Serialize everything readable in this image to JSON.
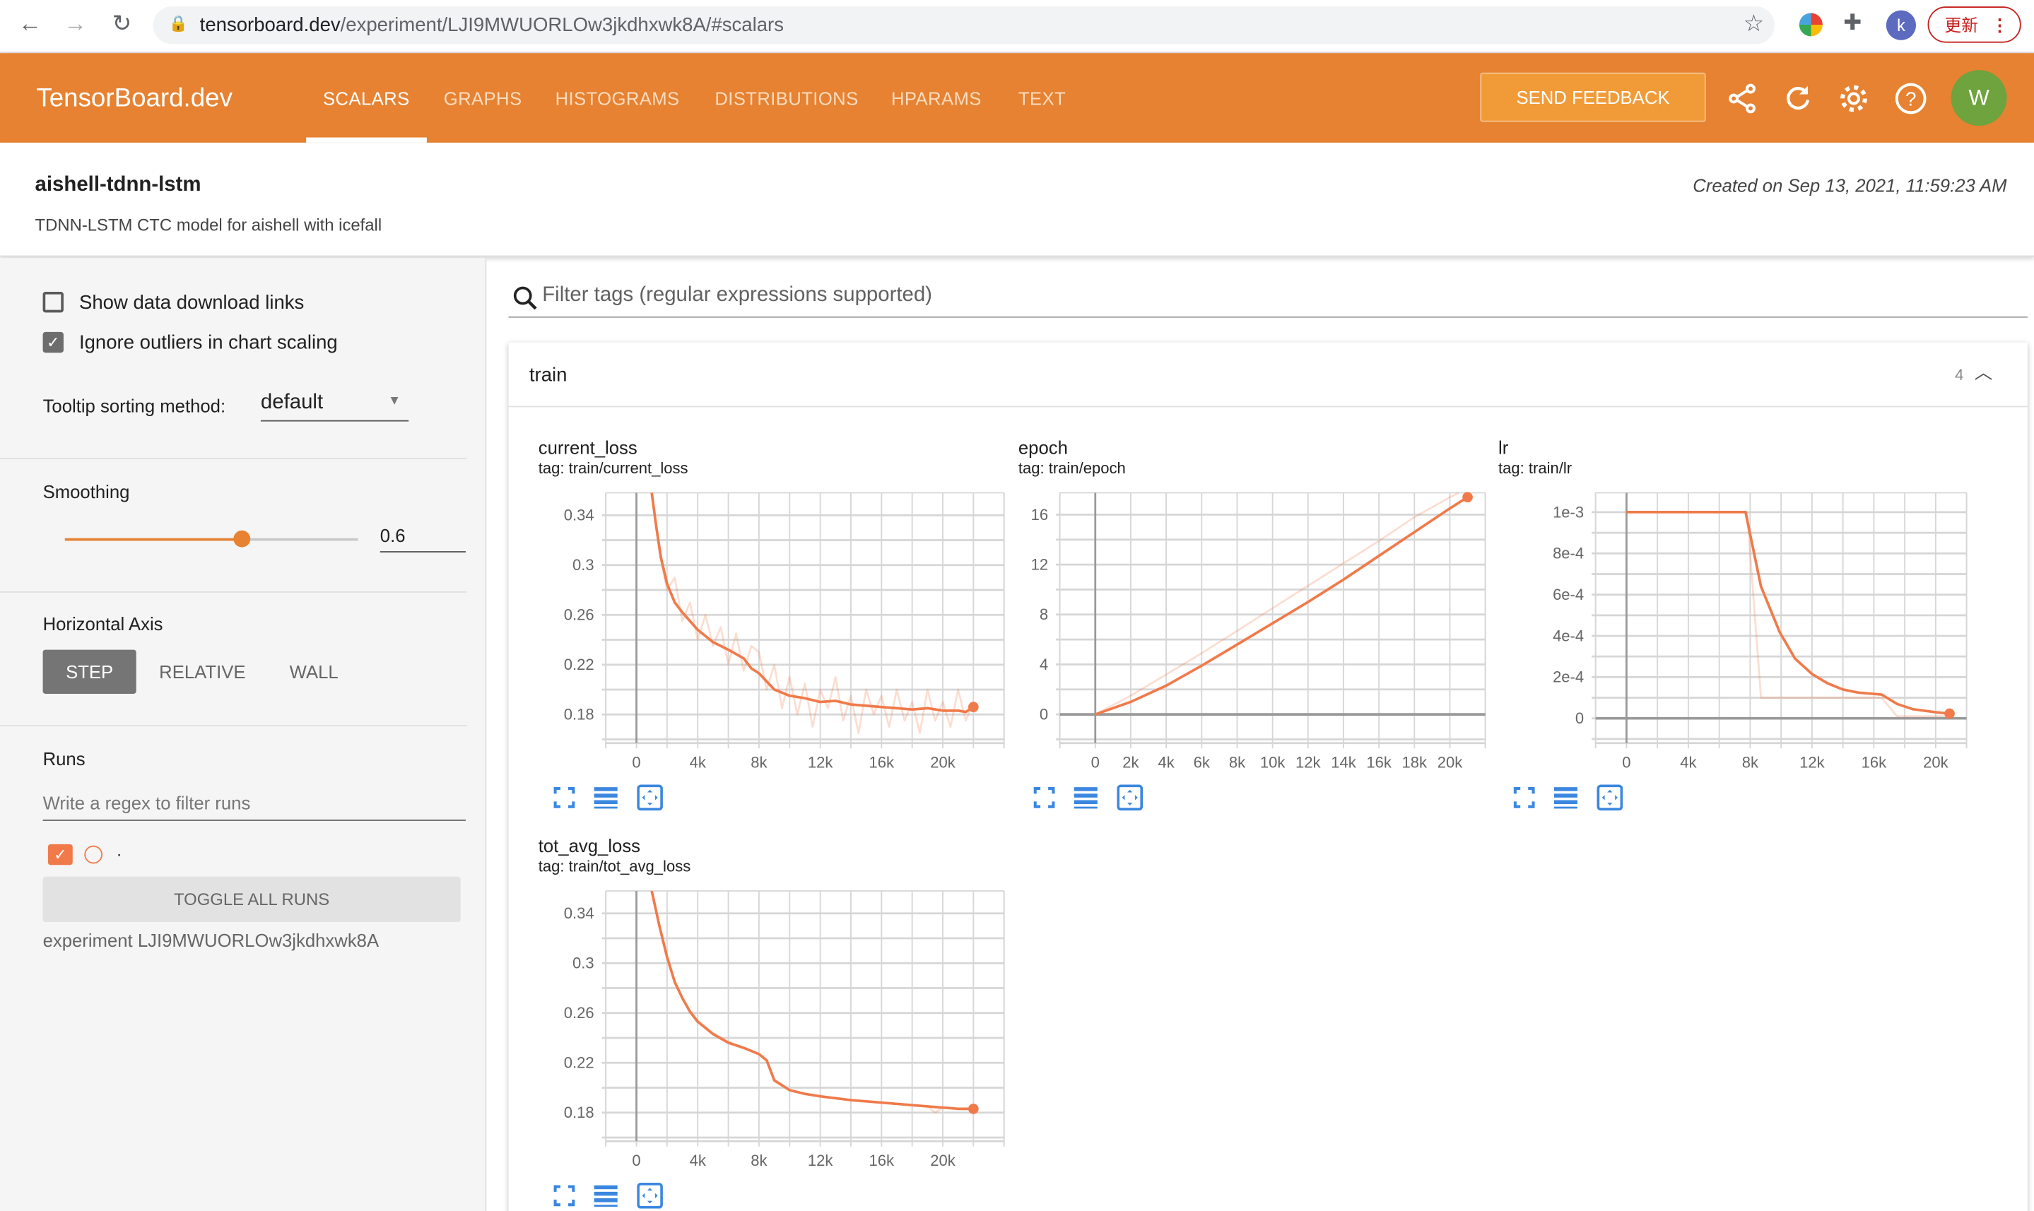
{
  "browser": {
    "url_host": "tensorboard.dev",
    "url_path": "/experiment/LJI9MWUORLOw3jkdhxwk8A/#scalars",
    "profile_initial": "k",
    "update_label": "更新"
  },
  "header": {
    "brand": "TensorBoard.dev",
    "tabs": [
      {
        "label": "SCALARS",
        "active": true
      },
      {
        "label": "GRAPHS"
      },
      {
        "label": "HISTOGRAMS"
      },
      {
        "label": "DISTRIBUTIONS"
      },
      {
        "label": "HPARAMS"
      },
      {
        "label": "TEXT"
      }
    ],
    "feedback_label": "SEND FEEDBACK",
    "avatar_initial": "W",
    "colors": {
      "brand": "#e68231",
      "avatar": "#6ea33e"
    }
  },
  "experiment": {
    "title": "aishell-tdnn-lstm",
    "description": "TDNN-LSTM CTC model for aishell with icefall",
    "created": "Created on Sep 13, 2021, 11:59:23 AM"
  },
  "sidebar": {
    "show_download_links": {
      "label": "Show data download links",
      "checked": false
    },
    "ignore_outliers": {
      "label": "Ignore outliers in chart scaling",
      "checked": true
    },
    "tooltip_label": "Tooltip sorting method:",
    "tooltip_value": "default",
    "smoothing_label": "Smoothing",
    "smoothing_value": "0.6",
    "smoothing_fraction": 0.6,
    "horizontal_axis_label": "Horizontal Axis",
    "axis_options": [
      "STEP",
      "RELATIVE",
      "WALL"
    ],
    "axis_selected": "STEP",
    "runs_label": "Runs",
    "runs_filter_placeholder": "Write a regex to filter runs",
    "runs": [
      {
        "name": ".",
        "checked": true,
        "color": "#f07a4a"
      }
    ],
    "toggle_all_label": "TOGGLE ALL RUNS",
    "experiment_label": "experiment LJI9MWUORLOw3jkdhxwk8A"
  },
  "main": {
    "filter_placeholder": "Filter tags (regular expressions supported)",
    "group": {
      "title": "train",
      "count": "4"
    }
  },
  "chart_data": [
    {
      "type": "line",
      "title": "current_loss",
      "tag": "tag: train/current_loss",
      "xlim": [
        -2000,
        24000
      ],
      "ylim": [
        0.157,
        0.358
      ],
      "xticks": {
        "values": [
          0,
          4000,
          8000,
          12000,
          16000,
          20000
        ],
        "labels": [
          "0",
          "4k",
          "8k",
          "12k",
          "16k",
          "20k"
        ]
      },
      "yticks": {
        "values": [
          0.18,
          0.22,
          0.26,
          0.3,
          0.34
        ],
        "labels": [
          "0.18",
          "0.22",
          "0.26",
          "0.3",
          "0.34"
        ]
      },
      "grid": true,
      "series": [
        {
          "role": "raw",
          "x": [
            1000,
            1500,
            2000,
            2500,
            3000,
            3500,
            4000,
            4500,
            5000,
            5500,
            6000,
            6500,
            7000,
            7500,
            8000,
            8500,
            9000,
            9500,
            10000,
            10500,
            11000,
            11500,
            12000,
            12500,
            13000,
            13500,
            14000,
            14500,
            15000,
            15500,
            16000,
            16500,
            17000,
            17500,
            18000,
            18500,
            19000,
            19500,
            20000,
            20500,
            21000,
            21500,
            22000
          ],
          "y": [
            0.36,
            0.31,
            0.28,
            0.29,
            0.255,
            0.27,
            0.24,
            0.26,
            0.235,
            0.25,
            0.22,
            0.245,
            0.215,
            0.235,
            0.23,
            0.2,
            0.22,
            0.185,
            0.21,
            0.18,
            0.205,
            0.17,
            0.2,
            0.185,
            0.21,
            0.175,
            0.195,
            0.165,
            0.2,
            0.18,
            0.195,
            0.17,
            0.2,
            0.175,
            0.19,
            0.165,
            0.2,
            0.175,
            0.19,
            0.17,
            0.2,
            0.175,
            0.19
          ]
        },
        {
          "role": "smoothed",
          "x": [
            1000,
            1300,
            1600,
            2000,
            2500,
            3000,
            3500,
            4000,
            5000,
            6000,
            7000,
            7500,
            8000,
            9000,
            10000,
            11000,
            12000,
            13000,
            14000,
            15000,
            16000,
            17000,
            18000,
            19000,
            20000,
            21000,
            21500,
            22000
          ],
          "y": [
            0.358,
            0.33,
            0.306,
            0.285,
            0.27,
            0.262,
            0.255,
            0.248,
            0.238,
            0.232,
            0.225,
            0.217,
            0.213,
            0.2,
            0.195,
            0.193,
            0.19,
            0.191,
            0.188,
            0.187,
            0.186,
            0.185,
            0.184,
            0.185,
            0.183,
            0.183,
            0.182,
            0.186
          ]
        }
      ]
    },
    {
      "type": "line",
      "title": "epoch",
      "tag": "tag: train/epoch",
      "xlim": [
        -2000,
        22000
      ],
      "ylim": [
        -2.3,
        17.75
      ],
      "xticks": {
        "values": [
          0,
          2000,
          4000,
          6000,
          8000,
          10000,
          12000,
          14000,
          16000,
          18000,
          20000
        ],
        "labels": [
          "0",
          "2k",
          "4k",
          "6k",
          "8k",
          "10k",
          "12k",
          "14k",
          "16k",
          "18k",
          "20k"
        ]
      },
      "yticks": {
        "values": [
          0,
          4,
          8,
          12,
          16
        ],
        "labels": [
          "0",
          "4",
          "8",
          "12",
          "16"
        ]
      },
      "grid": true,
      "series": [
        {
          "role": "raw",
          "x": [
            0,
            2000,
            4000,
            6000,
            8000,
            10000,
            12000,
            14000,
            16000,
            18000,
            20000,
            20500
          ],
          "y": [
            0,
            1.5,
            3.2,
            4.9,
            6.7,
            8.5,
            10.3,
            12.1,
            13.9,
            15.8,
            17.4,
            17.75
          ]
        },
        {
          "role": "smoothed",
          "x": [
            0,
            2000,
            4000,
            6000,
            8000,
            10000,
            12000,
            14000,
            16000,
            18000,
            20000,
            21000
          ],
          "y": [
            0,
            1.0,
            2.3,
            3.9,
            5.6,
            7.3,
            9.0,
            10.8,
            12.7,
            14.6,
            16.5,
            17.4
          ]
        }
      ]
    },
    {
      "type": "line",
      "title": "lr",
      "tag": "tag: train/lr",
      "xlim": [
        -2000,
        22000
      ],
      "ylim": [
        -0.00012,
        0.001094
      ],
      "xticks": {
        "values": [
          0,
          4000,
          8000,
          12000,
          16000,
          20000
        ],
        "labels": [
          "0",
          "4k",
          "8k",
          "12k",
          "16k",
          "20k"
        ]
      },
      "yticks": {
        "values": [
          0,
          0.0002,
          0.0004,
          0.0006,
          0.0008,
          0.001
        ],
        "labels": [
          "0",
          "2e-4",
          "4e-4",
          "6e-4",
          "8e-4",
          "1e-3"
        ]
      },
      "grid": true,
      "series": [
        {
          "role": "raw",
          "x": [
            0,
            7800,
            8700,
            16500,
            17500,
            21000
          ],
          "y": [
            0.001,
            0.001,
            0.0001,
            0.0001,
            1e-05,
            1e-05
          ]
        },
        {
          "role": "smoothed",
          "x": [
            0,
            7700,
            8700,
            9900,
            10900,
            12000,
            13000,
            14000,
            15000,
            16500,
            17500,
            18500,
            20000,
            20900
          ],
          "y": [
            0.001,
            0.001,
            0.00064,
            0.00042,
            0.00029,
            0.000215,
            0.00017,
            0.00014,
            0.000125,
            0.000115,
            7e-05,
            4.5e-05,
            3e-05,
            2.3e-05
          ]
        }
      ]
    },
    {
      "type": "line",
      "title": "tot_avg_loss",
      "tag": "tag: train/tot_avg_loss",
      "xlim": [
        -2000,
        24000
      ],
      "ylim": [
        0.157,
        0.358
      ],
      "xticks": {
        "values": [
          0,
          4000,
          8000,
          12000,
          16000,
          20000
        ],
        "labels": [
          "0",
          "4k",
          "8k",
          "12k",
          "16k",
          "20k"
        ]
      },
      "yticks": {
        "values": [
          0.18,
          0.22,
          0.26,
          0.3,
          0.34
        ],
        "labels": [
          "0.18",
          "0.22",
          "0.26",
          "0.3",
          "0.34"
        ]
      },
      "grid": true,
      "series": [
        {
          "role": "raw",
          "x": [
            1000,
            1500,
            2000,
            2500,
            3000,
            3500,
            4000,
            5000,
            6000,
            7000,
            8000,
            8500,
            9000,
            10000,
            11000,
            12000,
            14000,
            16000,
            18000,
            19000,
            19500,
            20000,
            21000,
            22000
          ],
          "y": [
            0.36,
            0.33,
            0.305,
            0.285,
            0.272,
            0.262,
            0.254,
            0.244,
            0.237,
            0.232,
            0.227,
            0.222,
            0.205,
            0.198,
            0.195,
            0.193,
            0.19,
            0.188,
            0.186,
            0.185,
            0.18,
            0.184,
            0.183,
            0.183
          ]
        },
        {
          "role": "smoothed",
          "x": [
            1000,
            1500,
            2000,
            2500,
            3000,
            3500,
            4000,
            5000,
            6000,
            7000,
            8000,
            8500,
            9000,
            10000,
            11000,
            12000,
            14000,
            16000,
            18000,
            20000,
            21000,
            22000
          ],
          "y": [
            0.358,
            0.33,
            0.305,
            0.285,
            0.272,
            0.261,
            0.253,
            0.243,
            0.236,
            0.232,
            0.227,
            0.222,
            0.206,
            0.198,
            0.195,
            0.193,
            0.19,
            0.188,
            0.186,
            0.184,
            0.183,
            0.183
          ]
        }
      ],
      "run_color": "#f07a4a"
    }
  ]
}
